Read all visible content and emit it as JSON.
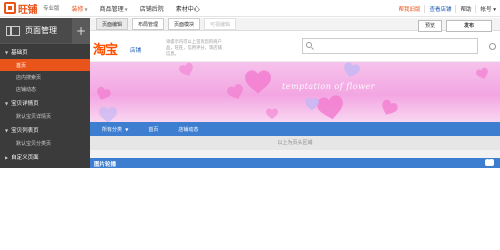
{
  "header": {
    "brand": "旺铺",
    "edition": "专业版",
    "nav": [
      {
        "label": "装修",
        "active": true,
        "caret": true
      },
      {
        "label": "商品管理",
        "active": false,
        "caret": true
      },
      {
        "label": "店铺后院",
        "active": false,
        "caret": false
      },
      {
        "label": "素材中心",
        "active": false,
        "caret": false
      }
    ],
    "right_links": [
      {
        "label": "帮我旧版",
        "style": "orange"
      },
      {
        "label": "查看店铺",
        "style": "blue"
      },
      {
        "label": "帮助",
        "style": "plain"
      },
      {
        "label": "帐号 ▾",
        "style": "plain"
      }
    ]
  },
  "sidebar": {
    "title": "页面管理",
    "add": "+",
    "groups": [
      {
        "label": "基础页",
        "items": [
          {
            "label": "首页",
            "active": true
          },
          {
            "label": "店内搜索页",
            "active": false
          },
          {
            "label": "店铺动态",
            "active": false
          }
        ]
      },
      {
        "label": "宝贝详情页",
        "items": [
          {
            "label": "默认宝贝详情页",
            "active": false
          }
        ]
      },
      {
        "label": "宝贝列表页",
        "items": [
          {
            "label": "默认宝贝分类页",
            "active": false
          }
        ]
      },
      {
        "label": "自定义页面",
        "items": []
      }
    ]
  },
  "toolbar": {
    "tabs": [
      {
        "label": "页面编辑",
        "state": "selected"
      },
      {
        "label": "布局管理",
        "state": "normal"
      },
      {
        "label": "页面模块",
        "state": "normal"
      },
      {
        "label": "可视编辑",
        "state": "disabled"
      }
    ],
    "preview": "预览",
    "publish": "发布"
  },
  "store_header": {
    "logo": "淘宝",
    "logo_sub": "店铺",
    "note": "添提示内可以上首页您的商户品，旺旺，信用评分，等店铺信息。",
    "search_placeholder": ""
  },
  "banner": {
    "text": "temptation of flower",
    "colors": {
      "top": "#f6c2ec",
      "mid": "#f3a6e2",
      "heart_pink": "#f27ed0",
      "heart_blue": "#c6b9f3"
    }
  },
  "store_nav": {
    "items": [
      {
        "label": "所有分类",
        "dropdown": true
      },
      {
        "label": "首页",
        "dropdown": false
      },
      {
        "label": "店铺动态",
        "dropdown": false
      }
    ],
    "color": "#3e7ed0"
  },
  "page_head_label": "以上为页头区域",
  "carousel": {
    "title": "图片轮播"
  }
}
